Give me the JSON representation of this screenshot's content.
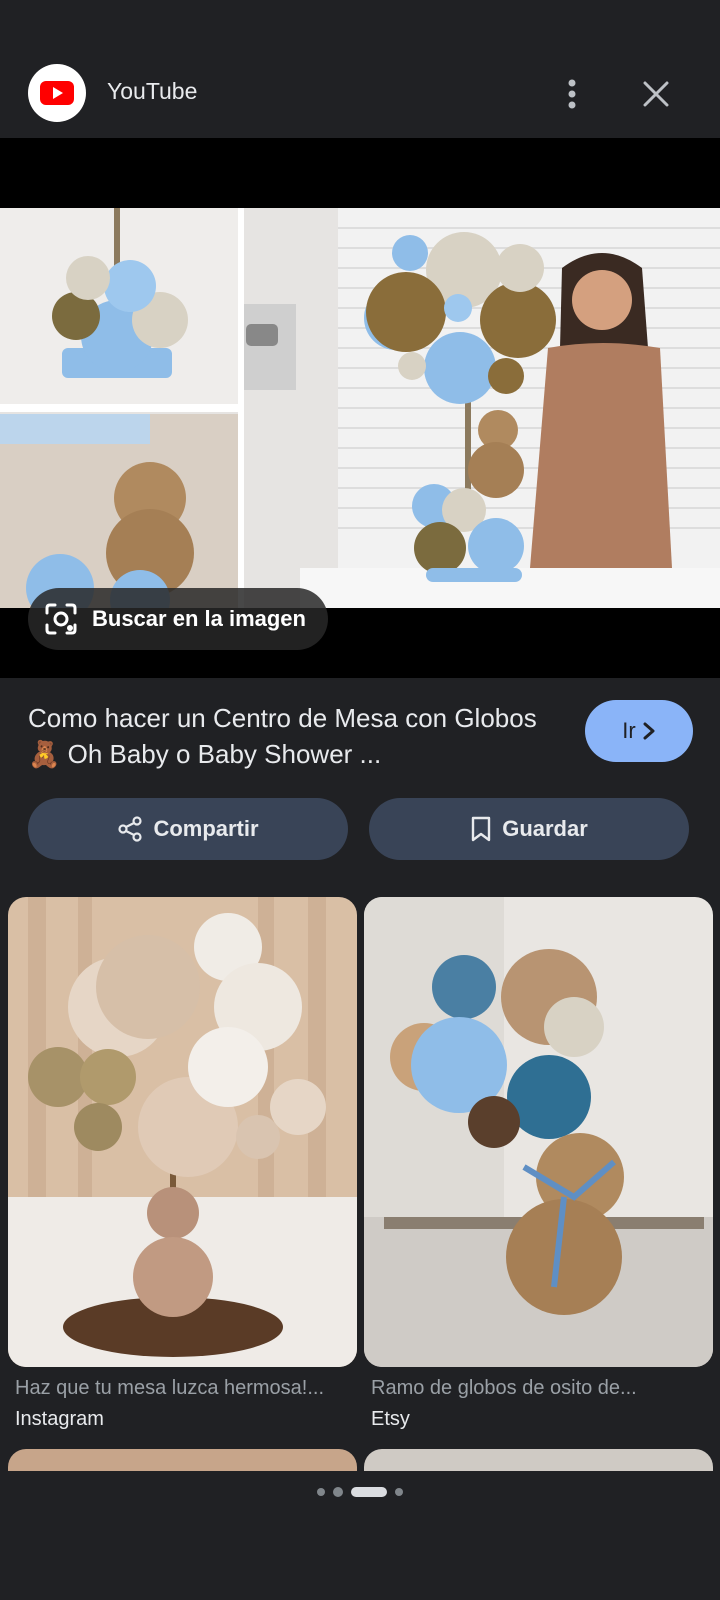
{
  "header": {
    "app_title": "YouTube"
  },
  "hero": {
    "lens_label": "Buscar en la imagen"
  },
  "result": {
    "title": "Como hacer un Centro de Mesa con Globos 🧸 Oh Baby o Baby Shower ...",
    "go_label": "Ir"
  },
  "actions": {
    "share_label": "Compartir",
    "save_label": "Guardar"
  },
  "related": [
    {
      "caption": "Haz que tu mesa luzca hermosa!...",
      "source": "Instagram"
    },
    {
      "caption": "Ramo de globos de osito de...",
      "source": "Etsy"
    }
  ],
  "pagination": {
    "count": 4,
    "active": 2
  },
  "colors": {
    "background": "#202124",
    "accent": "#8ab4f8",
    "button": "#394457",
    "youtube_red": "#ff0000"
  }
}
